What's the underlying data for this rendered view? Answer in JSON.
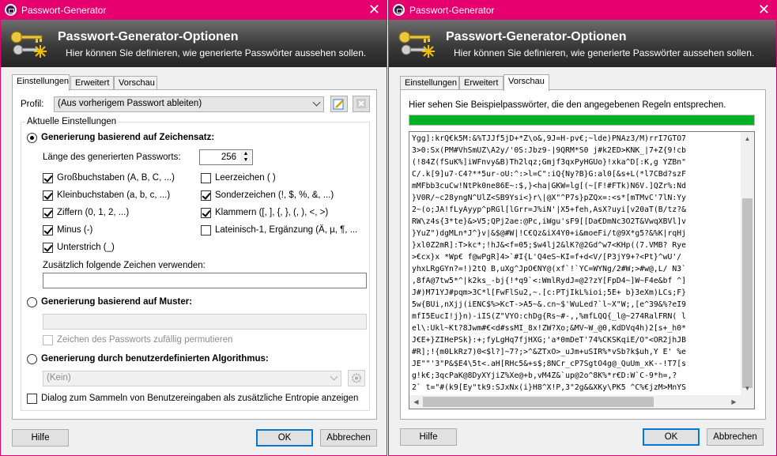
{
  "window_title": "Passwort-Generator",
  "banner": {
    "title": "Passwort-Generator-Optionen",
    "subtitle": "Hier können Sie definieren, wie generierte Passwörter aussehen sollen."
  },
  "tabs": [
    "Einstellungen",
    "Erweitert",
    "Vorschau"
  ],
  "left": {
    "profile_label": "Profil:",
    "profile_value": "(Aus vorherigem Passwort ableiten)",
    "group_label": "Aktuelle Einstellungen",
    "charset_radio": "Generierung basierend auf Zeichensatz:",
    "length_label": "Länge des generierten Passworts:",
    "length_value": "256",
    "checkboxes_col1": [
      {
        "label": "Großbuchstaben (A, B, C, ...)",
        "checked": true
      },
      {
        "label": "Kleinbuchstaben (a, b, c, ...)",
        "checked": true
      },
      {
        "label": "Ziffern (0, 1, 2, ...)",
        "checked": true
      },
      {
        "label": "Minus (-)",
        "checked": true
      },
      {
        "label": "Unterstrich (_)",
        "checked": true
      }
    ],
    "checkboxes_col2": [
      {
        "label": "Leerzeichen ( )",
        "checked": false
      },
      {
        "label": "Sonderzeichen (!, $, %, &, ...)",
        "checked": true
      },
      {
        "label": "Klammern ([, ], {, }, (, ), <, >)",
        "checked": true
      },
      {
        "label": "Lateinisch-1, Ergänzung (Ä, µ, ¶, ...",
        "checked": false
      }
    ],
    "additional_label": "Zusätzlich folgende Zeichen verwenden:",
    "additional_value": "",
    "pattern_radio": "Generierung basierend auf Muster:",
    "pattern_value": "",
    "permute_label": "Zeichen des Passworts zufällig permutieren",
    "algorithm_radio": "Generierung durch benutzerdefinierten Algorithmus:",
    "algorithm_value": "(Kein)",
    "entropy_label": "Dialog zum Sammeln von Benutzereingaben als zusätzliche Entropie anzeigen"
  },
  "right": {
    "preview_label": "Hier sehen Sie Beispielpasswörter, die den angegebenen Regeln entsprechen.",
    "progress_fraction": 1.0,
    "passwords": [
      "Ygg]:krQ€k5M:&%TJJf5jD+*Z\\o&,9J=H-pv€;~lde)PNAz3/M)rrI7GTO7",
      "3>0:Sx(PM#VhSmUZ\\A2y/'0S:Jbz9-|9QRM*S0 j#k2ED>KNK_|7+Z{9!cb",
      "(!84Z(fSuK%]iWFnvy&B)Th2lqz;Gmjf3qxPyHGUo}!xka^D[:K,g YZBn\"",
      "C/.k[9]u7-C4?**5ur-oU:^:>l=C\":iQ{Ny?B}G:al0[&s+L(*l7CBd?szF",
      "mMFbb3cuCw!NtPk0ne86E~:$,}<ha|GKW=lg[(~[F!#FTk)N6V.]QZr%:Nd",
      "}V0R/~c28yngN^UlZ<SB9Ysi<}r\\|@X\"^P7s}pZQx=:<s*[mTMvC'7lN:Yy",
      "2~(o;JA!fLyAyyp^pRGl[lGrr=J%iN'|X5+feh,AsX?uyi[v20aT(B/tz?&",
      "RW\\z4s{3*te}&>V5;QPj2ae:@Pc,iWgu'sF9[[Da€DmNc3O2T&VwqXBVl]v",
      "}YuZ\")dgMLn*J^}v|&$@#W|!C€Qz&iX4Y0+i&moeFi/t@9X*g5?&%K|rqHj",
      "}xl0Z2mR]:T>kc*;!hJ&<f=05;$w4lj2&lK?@2Gd^w7<KHp((7.VMB? Rye",
      ">€cx}x *Wp€ f@wPgR]4>`#I{L'Q4eS~KI=f+d<V/[P3jY9+?<Pt}^wU'/",
      "yhxLRgGYn?=!)2tQ B,uXg^JpO€NY@(xf`!`YC=WYNg/2#W;>#w@,L/ N3`",
      ",8fA@7tw5*^|k2ks_-bj{!*q9`<:WmlRydJ=@2?zY[FpD4~]W~F4e&bf ^]",
      "J#)M71YJ#pqm>3C*l[FwFlSu2,~.[c:PTjIkL%ioi;5E+ b}3eXm)LCs;F}",
      "5w{BUi,nXjj(iENC$%>KcT->A5~&.cn~$'WuLed?`l~X\"W;,[e^39&%?eI9",
      "mfI5EucI!j}n)-iIS(Z\"VYO:chDg{Rs~#-,,%mfLQQ{_l@~274RalFRN( l",
      "el\\:Ukl~Kt?8Jwm#€<d#ssMI_8x!ZW?Xo;&MV~W_@0,KdDVq4h)2[s+_h0*",
      "J€E+}ZIHePSk}:+;fyLgHq7fjHXG;'a*0mDeT'74%CKSKqiE/O\"<OR2jhJB",
      "#R];!{m0LkRz7)0<$l?]~7?;>^&ZTxO>_uJm+uSIR%*vSb?k$uh,Y E' %e",
      "JE\"\"'3\"P&$E4\\5t<.aH[RHc5&+s$;8NCr_cP7SgtO4g@_QuUm_xK--!T7[s",
      "g!k€;3qcPaK@8DyXYjiZ%Xe@+b,vM4Z&`up@2o^8K%*r€D:W`C-9*h=,?",
      "2` t=\"#(k9[Ey\"tk9:SJxNx(i}H8^X!P,3\"2g&&XKy\\PK5 ^C%€jzM>MnYS",
      "3F}*$+<ljk{C)%P$* sut>mG^M}$!chI8t>iU_|OAiaSZE?(^*zW!&e'xh,"
    ]
  },
  "buttons": {
    "help": "Hilfe",
    "ok": "OK",
    "cancel": "Abbrechen"
  }
}
